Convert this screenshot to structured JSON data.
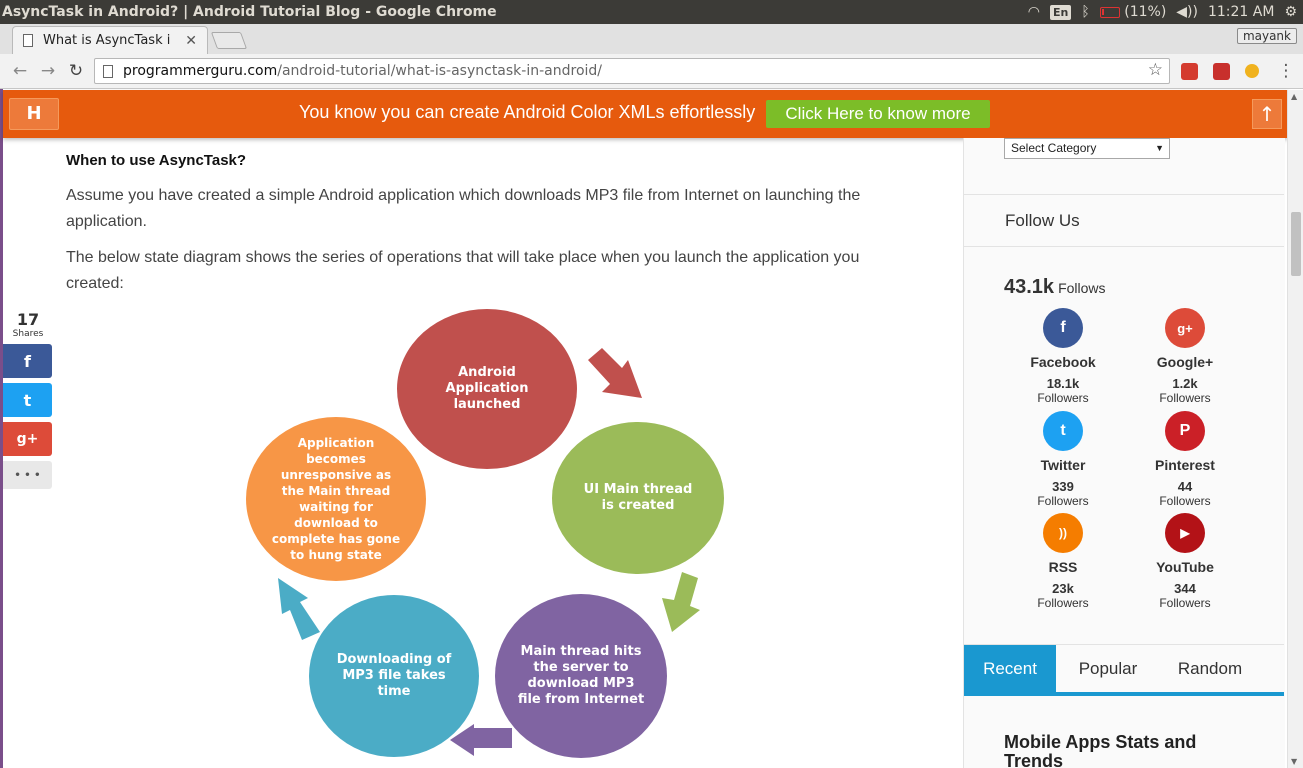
{
  "os": {
    "window_title": "AsyncTask in Android? | Android Tutorial Blog - Google Chrome",
    "lang": "En",
    "battery": "(11%)",
    "time": "11:21 AM"
  },
  "browser": {
    "tab_title": "What is AsyncTask i",
    "user": "mayank",
    "url_domain": "programmerguru.com",
    "url_path": "/android-tutorial/what-is-asynctask-in-android/"
  },
  "promo": {
    "logo": "H",
    "text": "You know you can create Android Color XMLs effortlessly",
    "button": "Click Here to know more",
    "up": "↑"
  },
  "article": {
    "heading": "When to use AsyncTask?",
    "p1": "Assume you have created a simple Android application which downloads MP3 file from Internet on launching the application.",
    "p2": "The below state diagram shows the series of operations that will take place when you launch the application you created:"
  },
  "diagram": {
    "steps": [
      {
        "label": "Android Application launched",
        "color": "#c0504d"
      },
      {
        "label": "UI Main thread is created",
        "color": "#9bbb59"
      },
      {
        "label": "Main thread  hits the server to download MP3 file from Internet",
        "color": "#8064a2"
      },
      {
        "label": "Downloading of MP3 file takes time",
        "color": "#4bacc6"
      },
      {
        "label": "Application becomes unresponsive as the Main thread waiting for download to complete has gone to hung state",
        "color": "#f79646"
      }
    ]
  },
  "share": {
    "count": "17",
    "label": "Shares",
    "facebook": "f",
    "twitter": "t",
    "google": "g+",
    "more": "• • •"
  },
  "sidebar": {
    "category_select": "Select Category",
    "follow_title": "Follow Us",
    "total": "43.1k",
    "total_label": "Follows",
    "networks": [
      {
        "name": "Facebook",
        "count": "18.1k",
        "label": "Followers",
        "icon": "facebook-icon",
        "glyph": "f",
        "color": "#3b5998"
      },
      {
        "name": "Google+",
        "count": "1.2k",
        "label": "Followers",
        "icon": "google-plus-icon",
        "glyph": "g+",
        "color": "#dd4b39"
      },
      {
        "name": "Twitter",
        "count": "339",
        "label": "Followers",
        "icon": "twitter-icon",
        "glyph": "t",
        "color": "#1da1f2"
      },
      {
        "name": "Pinterest",
        "count": "44",
        "label": "Followers",
        "icon": "pinterest-icon",
        "glyph": "P",
        "color": "#cb2027"
      },
      {
        "name": "RSS",
        "count": "23k",
        "label": "Followers",
        "icon": "rss-icon",
        "glyph": "))",
        "color": "#f57d00"
      },
      {
        "name": "YouTube",
        "count": "344",
        "label": "Followers",
        "icon": "youtube-icon",
        "glyph": "▶",
        "color": "#b31217"
      }
    ],
    "tabs": [
      "Recent",
      "Popular",
      "Random"
    ],
    "widget_title": "Mobile Apps Stats and Trends"
  }
}
